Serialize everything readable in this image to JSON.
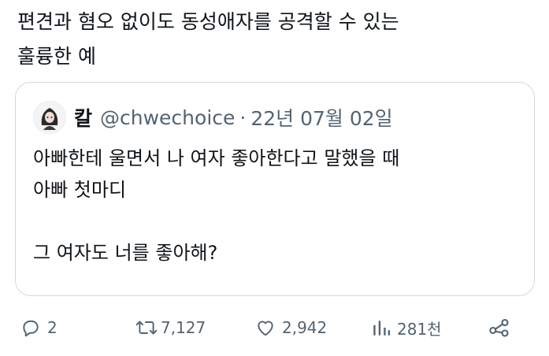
{
  "tweet": {
    "text_line_1": "편견과 혐오 없이도 동성애자를 공격할 수 있는",
    "text_line_2": "훌륭한 예"
  },
  "quoted_tweet": {
    "display_name": "칼",
    "handle": "@chwechoice",
    "separator": "·",
    "date": "22년 07월 02일",
    "body_line_1": "아빠한테 울면서 나 여자 좋아한다고 말했을 때",
    "body_line_2": "아빠 첫마디",
    "body_line_3": "그 여자도 너를 좋아해?"
  },
  "actions": {
    "reply_count": "2",
    "retweet_count": "7,127",
    "like_count": "2,942",
    "view_count": "281천"
  },
  "icons": {
    "reply": "reply-icon",
    "retweet": "retweet-icon",
    "like": "heart-icon",
    "views": "views-chart-icon",
    "share": "share-icon"
  },
  "colors": {
    "text": "#0f1419",
    "secondary": "#536471",
    "border": "#cfd9de"
  }
}
